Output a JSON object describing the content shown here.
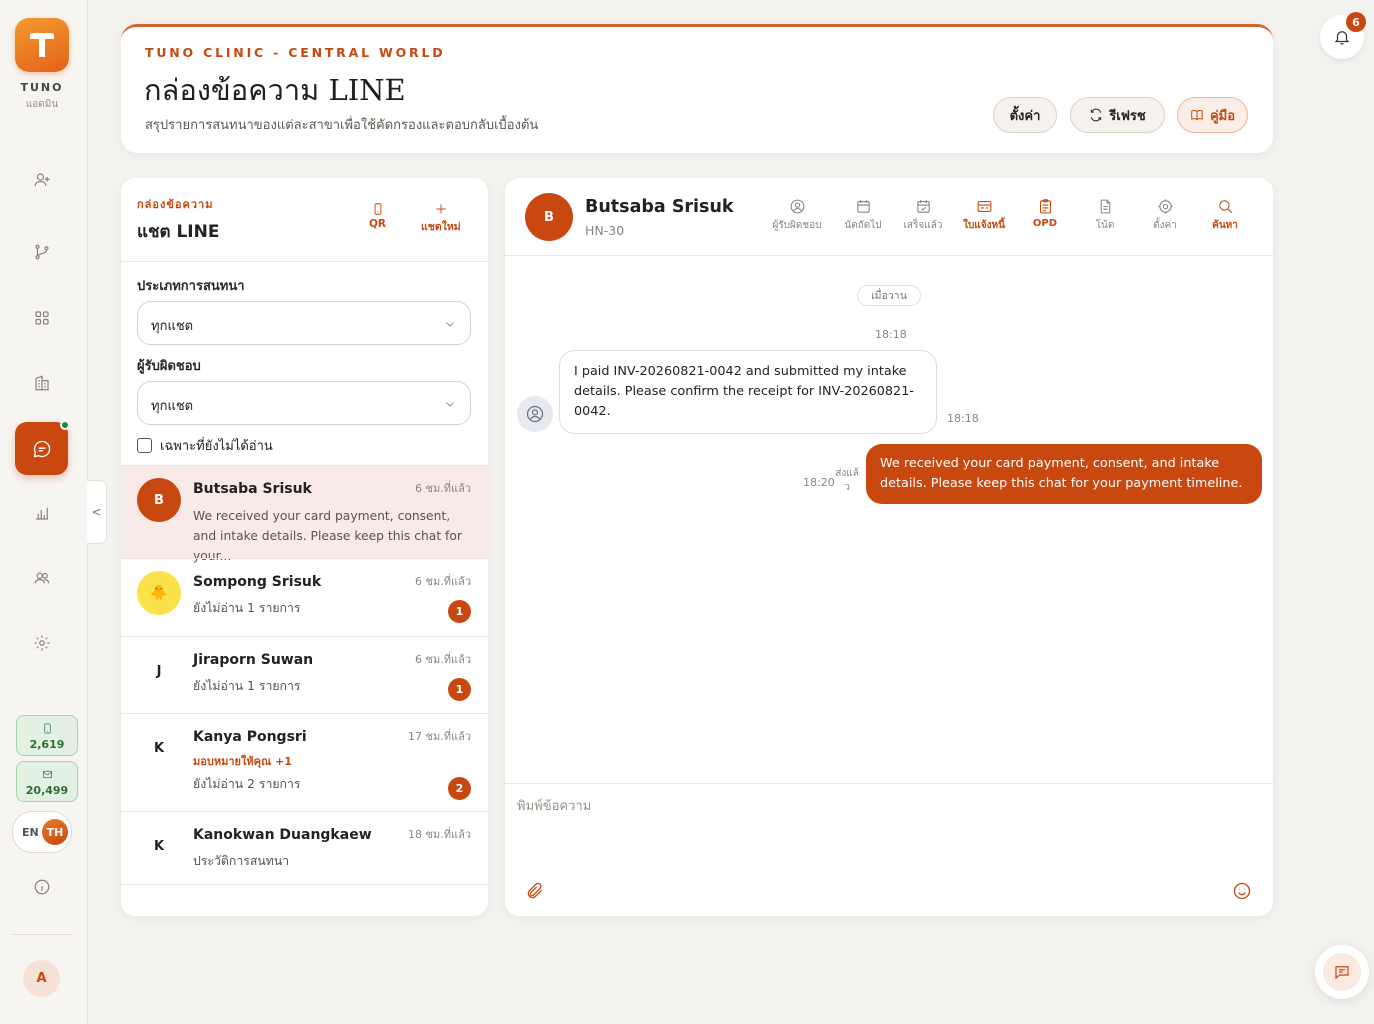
{
  "sidebar": {
    "brand": "TUNO",
    "role": "แอดมิน",
    "nav_icons": [
      "add-user-icon",
      "branch-icon",
      "grid-icon",
      "building-icon",
      "chat-icon",
      "chart-icon",
      "users-icon",
      "gear-icon"
    ],
    "active_item": "chat-icon",
    "sms_credit": "2,619",
    "email_credit": "20,499",
    "lang_en": "EN",
    "lang_th": "TH",
    "user_initial": "A"
  },
  "notifications": {
    "count": "6"
  },
  "header": {
    "clinic": "TUNO CLINIC - CENTRAL WORLD",
    "title": "กล่องข้อความ LINE",
    "subtitle": "สรุปรายการสนทนาของแต่ละสาขาเพื่อใช้คัดกรองและตอบกลับเบื้องต้น",
    "buttons": {
      "settings": "ตั้งค่า",
      "refresh": "รีเฟรช",
      "manual": "คู่มือ"
    }
  },
  "inbox": {
    "kicker": "กล่องข้อความ",
    "title": "แชต LINE",
    "qr_label": "QR",
    "new_chat_label": "แชตใหม่",
    "filter_type_label": "ประเภทการสนทนา",
    "filter_type_value": "ทุกแชต",
    "filter_owner_label": "ผู้รับผิดชอบ",
    "filter_owner_value": "ทุกแชต",
    "unread_only_label": "เฉพาะที่ยังไม่ได้อ่าน",
    "chats": [
      {
        "initial": "B",
        "name": "Butsaba Srisuk",
        "time": "6 ชม.ที่แล้ว",
        "preview": "We received your card payment, consent, and intake details. Please keep this chat for your...",
        "active": true
      },
      {
        "initial": "🐥",
        "name": "Sompong Srisuk",
        "time": "6 ชม.ที่แล้ว",
        "preview": "ยังไม่อ่าน 1 รายการ",
        "badge": "1"
      },
      {
        "initial": "J",
        "name": "Jiraporn Suwan",
        "time": "6 ชม.ที่แล้ว",
        "preview": "ยังไม่อ่าน 1 รายการ",
        "badge": "1"
      },
      {
        "initial": "K",
        "name": "Kanya Pongsri",
        "time": "17 ชม.ที่แล้ว",
        "tag": "มอบหมายให้คุณ +1",
        "preview": "ยังไม่อ่าน 2 รายการ",
        "badge": "2"
      },
      {
        "initial": "K",
        "name": "Kanokwan Duangkaew",
        "time": "18 ชม.ที่แล้ว",
        "preview": "ประวัติการสนทนา"
      }
    ]
  },
  "conversation": {
    "initial": "B",
    "name": "Butsaba Srisuk",
    "hn": "HN-30",
    "tools": [
      {
        "icon": "user-circle-icon",
        "label": "ผู้รับผิดชอบ"
      },
      {
        "icon": "calendar-icon",
        "label": "นัดถัดไป"
      },
      {
        "icon": "calendar-check-icon",
        "label": "เสร็จแล้ว"
      },
      {
        "icon": "invoice-icon",
        "label": "ใบแจ้งหนี้"
      },
      {
        "icon": "clipboard-icon",
        "label": "OPD"
      },
      {
        "icon": "note-icon",
        "label": "โน้ต"
      },
      {
        "icon": "gear-icon",
        "label": "ตั้งค่า"
      },
      {
        "icon": "search-icon",
        "label": "ค้นหา"
      }
    ],
    "day_label": "เมื่อวาน",
    "messages": [
      {
        "direction": "in",
        "time": "18:18",
        "text": "I paid INV-20260821-0042 and submitted my intake details. Please confirm the receipt for INV-20260821-0042."
      },
      {
        "direction": "out",
        "time": "18:20",
        "status": "ส่งแล้ว",
        "text": "We received your card payment, consent, and intake details. Please keep this chat for your payment timeline."
      }
    ],
    "header_time": "18:18",
    "compose_placeholder": "พิมพ์ข้อความ"
  },
  "colors": {
    "accent": "#c8480f",
    "accent_light": "#f8ebe7",
    "credit_green": "#2d6e3a"
  }
}
